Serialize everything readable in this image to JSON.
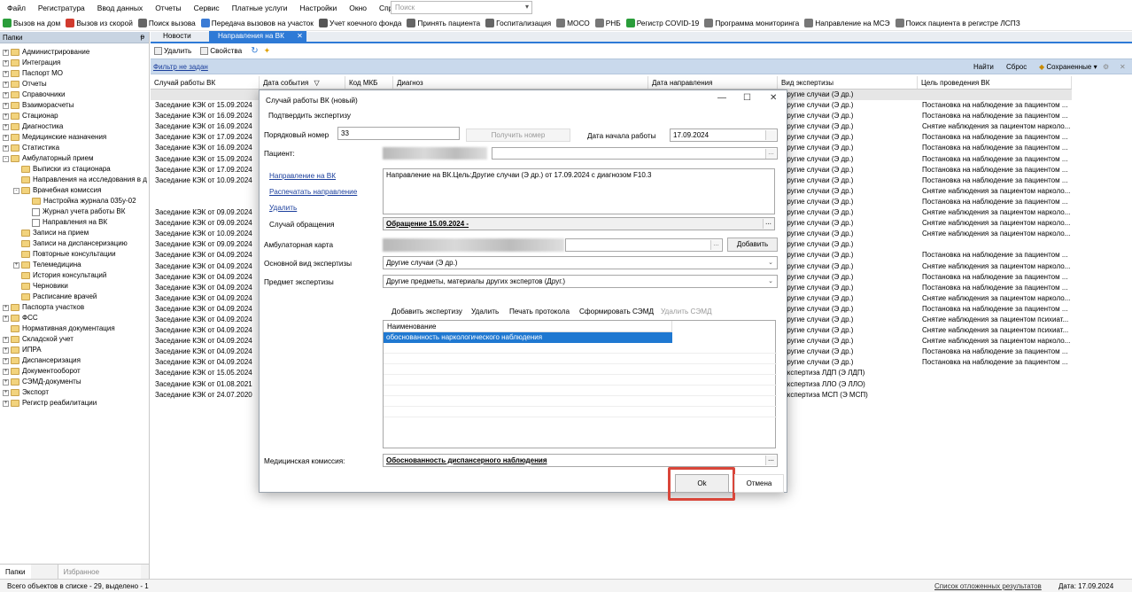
{
  "menu": [
    "Файл",
    "Регистратура",
    "Ввод данных",
    "Отчеты",
    "Сервис",
    "Платные услуги",
    "Настройки",
    "Окно",
    "Справка"
  ],
  "search": {
    "placeholder": "Поиск"
  },
  "toolbar": [
    {
      "label": "Вызов на дом",
      "icon": "home-call-icon",
      "color": "#2a9d3a"
    },
    {
      "label": "Вызов из скорой",
      "icon": "ambulance-call-icon",
      "color": "#d13a2e"
    },
    {
      "label": "Поиск вызова",
      "icon": "search-call-icon",
      "color": "#666"
    },
    {
      "label": "Передача вызовов на участок",
      "icon": "transfer-icon",
      "color": "#3a7bd5"
    },
    {
      "label": "Учет коечного фонда",
      "icon": "bed-icon",
      "color": "#555"
    },
    {
      "label": "Принять пациента",
      "icon": "accept-patient-icon",
      "color": "#666"
    },
    {
      "label": "Госпитализация",
      "icon": "hospital-icon",
      "color": "#666"
    },
    {
      "label": "МОСО",
      "icon": "moso-icon",
      "color": "#777"
    },
    {
      "label": "РНБ",
      "icon": "rnb-icon",
      "color": "#777"
    },
    {
      "label": "Регистр COVID-19",
      "icon": "covid-icon",
      "color": "#2a9d3a"
    },
    {
      "label": "Программа мониторинга",
      "icon": "monitoring-icon",
      "color": "#777"
    },
    {
      "label": "Направление на МСЭ",
      "icon": "mse-icon",
      "color": "#777"
    },
    {
      "label": "Поиск пациента в регистре ЛСПЗ",
      "icon": "register-search-icon",
      "color": "#777"
    }
  ],
  "left_panel": {
    "title": "Папки",
    "tree": [
      {
        "label": "Администрирование",
        "level": 0,
        "exp": "+"
      },
      {
        "label": "Интеграция",
        "level": 0,
        "exp": "+"
      },
      {
        "label": "Паспорт МО",
        "level": 0,
        "exp": "+"
      },
      {
        "label": "Отчеты",
        "level": 0,
        "exp": "+"
      },
      {
        "label": "Справочники",
        "level": 0,
        "exp": "+"
      },
      {
        "label": "Взаиморасчеты",
        "level": 0,
        "exp": "+"
      },
      {
        "label": "Стационар",
        "level": 0,
        "exp": "+"
      },
      {
        "label": "Диагностика",
        "level": 0,
        "exp": "+"
      },
      {
        "label": "Медицинские назначения",
        "level": 0,
        "exp": "+"
      },
      {
        "label": "Статистика",
        "level": 0,
        "exp": "+"
      },
      {
        "label": "Амбулаторный прием",
        "level": 0,
        "exp": "-"
      },
      {
        "label": "Выписки из стационара",
        "level": 1,
        "exp": ""
      },
      {
        "label": "Направления на исследования в д",
        "level": 1,
        "exp": ""
      },
      {
        "label": "Врачебная комиссия",
        "level": 1,
        "exp": "-"
      },
      {
        "label": "Настройка журнала 035у-02",
        "level": 2,
        "exp": ""
      },
      {
        "label": "Журнал учета работы ВК",
        "level": 2,
        "exp": "",
        "doc": true
      },
      {
        "label": "Направления на ВК",
        "level": 2,
        "exp": "",
        "doc": true
      },
      {
        "label": "Записи на прием",
        "level": 1,
        "exp": ""
      },
      {
        "label": "Записи на диспансеризацию",
        "level": 1,
        "exp": ""
      },
      {
        "label": "Повторные консультации",
        "level": 1,
        "exp": ""
      },
      {
        "label": "Телемедицина",
        "level": 1,
        "exp": "+"
      },
      {
        "label": "История консультаций",
        "level": 1,
        "exp": ""
      },
      {
        "label": "Черновики",
        "level": 1,
        "exp": ""
      },
      {
        "label": "Расписание врачей",
        "level": 1,
        "exp": ""
      },
      {
        "label": "Паспорта участков",
        "level": 0,
        "exp": "+"
      },
      {
        "label": "ФСС",
        "level": 0,
        "exp": "+"
      },
      {
        "label": "Нормативная документация",
        "level": 0,
        "exp": ""
      },
      {
        "label": "Складской учет",
        "level": 0,
        "exp": "+"
      },
      {
        "label": "ИПРА",
        "level": 0,
        "exp": "+"
      },
      {
        "label": "Диспансеризация",
        "level": 0,
        "exp": "+"
      },
      {
        "label": "Документооборот",
        "level": 0,
        "exp": "+"
      },
      {
        "label": "СЭМД-документы",
        "level": 0,
        "exp": "+"
      },
      {
        "label": "Экспорт",
        "level": 0,
        "exp": "+"
      },
      {
        "label": "Регистр реабилитации",
        "level": 0,
        "exp": "+"
      }
    ],
    "bottom_tabs": [
      "Папки",
      "Избранное"
    ]
  },
  "tabs": [
    "Новости",
    "Направления на ВК"
  ],
  "subtoolbar": {
    "delete": "Удалить",
    "properties": "Свойства"
  },
  "filter": {
    "label": "Фильтр не задан",
    "find": "Найти",
    "reset": "Сброс",
    "saved": "Сохраненные"
  },
  "grid": {
    "columns": [
      "Случай работы ВК",
      "Дата события",
      "Код МКБ",
      "Диагноз",
      "Дата направления",
      "Вид экспертизы",
      "Цель проведения ВК"
    ],
    "rows": [
      [
        "",
        "",
        "Другие случаи (Э др.)",
        ""
      ],
      [
        "Заседание КЭК от 15.09.2024",
        "",
        "Другие случаи (Э др.)",
        "Постановка на наблюдение за пациентом ..."
      ],
      [
        "Заседание КЭК от 16.09.2024",
        "",
        "Другие случаи (Э др.)",
        "Постановка на наблюдение за пациентом ..."
      ],
      [
        "Заседание КЭК от 16.09.2024",
        "",
        "Другие случаи (Э др.)",
        "Снятие наблюдения за пациентом нарколо..."
      ],
      [
        "Заседание КЭК от 17.09.2024",
        "",
        "Другие случаи (Э др.)",
        "Постановка на наблюдение за пациентом ..."
      ],
      [
        "Заседание КЭК от 16.09.2024",
        "",
        "Другие случаи (Э др.)",
        "Постановка на наблюдение за пациентом ..."
      ],
      [
        "Заседание КЭК от 15.09.2024",
        "",
        "Другие случаи (Э др.)",
        "Постановка на наблюдение за пациентом ..."
      ],
      [
        "Заседание КЭК от 17.09.2024",
        "",
        "Другие случаи (Э др.)",
        "Постановка на наблюдение за пациентом ..."
      ],
      [
        "Заседание КЭК от 10.09.2024",
        "",
        "Другие случаи (Э др.)",
        "Постановка на наблюдение за пациентом ..."
      ],
      [
        "",
        "",
        "Другие случаи (Э др.)",
        "Снятие наблюдения за пациентом нарколо..."
      ],
      [
        "",
        "",
        "Другие случаи (Э др.)",
        "Постановка на наблюдение за пациентом ..."
      ],
      [
        "Заседание КЭК от 09.09.2024",
        "",
        "Другие случаи (Э др.)",
        "Снятие наблюдения за пациентом нарколо..."
      ],
      [
        "Заседание КЭК от 09.09.2024",
        "",
        "Другие случаи (Э др.)",
        "Снятие наблюдения за пациентом нарколо..."
      ],
      [
        "Заседание КЭК от 10.09.2024",
        "",
        "Другие случаи (Э др.)",
        "Снятие наблюдения за пациентом нарколо..."
      ],
      [
        "Заседание КЭК от 09.09.2024",
        "",
        "Другие случаи (Э др.)",
        ""
      ],
      [
        "Заседание КЭК от 04.09.2024",
        "",
        "Другие случаи (Э др.)",
        "Постановка на наблюдение за пациентом ..."
      ],
      [
        "Заседание КЭК от 04.09.2024",
        "",
        "Другие случаи (Э др.)",
        "Снятие наблюдения за пациентом нарколо..."
      ],
      [
        "Заседание КЭК от 04.09.2024",
        "",
        "Другие случаи (Э др.)",
        "Постановка на наблюдение за пациентом ..."
      ],
      [
        "Заседание КЭК от 04.09.2024",
        "",
        "Другие случаи (Э др.)",
        "Постановка на наблюдение за пациентом ..."
      ],
      [
        "Заседание КЭК от 04.09.2024",
        "",
        "Другие случаи (Э др.)",
        "Снятие наблюдения за пациентом нарколо..."
      ],
      [
        "Заседание КЭК от 04.09.2024",
        "",
        "Другие случаи (Э др.)",
        "Постановка на наблюдение за пациентом ..."
      ],
      [
        "Заседание КЭК от 04.09.2024",
        "",
        "Другие случаи (Э др.)",
        "Снятие наблюдения за пациентом психиат..."
      ],
      [
        "Заседание КЭК от 04.09.2024",
        "",
        "Другие случаи (Э др.)",
        "Снятие наблюдения за пациентом психиат..."
      ],
      [
        "Заседание КЭК от 04.09.2024",
        "",
        "Другие случаи (Э др.)",
        "Снятие наблюдения за пациентом нарколо..."
      ],
      [
        "Заседание КЭК от 04.09.2024",
        "",
        "Другие случаи (Э др.)",
        "Постановка на наблюдение за пациентом ..."
      ],
      [
        "Заседание КЭК от 04.09.2024",
        "",
        "Другие случаи (Э др.)",
        "Постановка на наблюдение за пациентом ..."
      ],
      [
        "Заседание КЭК от 15.05.2024",
        "",
        "Экспертиза ЛДП (Э ЛДП)",
        ""
      ],
      [
        "Заседание КЭК от 01.08.2021",
        "",
        "Экспертиза ЛЛО (Э ЛЛО)",
        ""
      ],
      [
        "Заседание КЭК от 24.07.2020",
        "",
        "Экспертиза МСП (Э МСП)",
        ""
      ]
    ]
  },
  "status": {
    "count": "Всего объектов в списке - 29, выделено - 1",
    "deferred": "Список отложенных результатов",
    "date": "Дата: 17.09.2024"
  },
  "dialog": {
    "title": "Случай работы ВК (новый)",
    "confirm": "Подтвердить экспертизу",
    "order_label": "Порядковый номер",
    "order_value": "33",
    "get_number": "Получить номер",
    "start_date_label": "Дата начала работы",
    "start_date_value": "17.09.2024",
    "patient_label": "Пациент:",
    "link_referral": "Направление на ВК",
    "link_print": "Распечатать направление",
    "link_delete": "Удалить",
    "referral_text": "Направление на ВК.Цель:Другие случаи (Э др.) от 17.09.2024 с диагнозом F10.3",
    "case_label": "Случай обращения",
    "case_value": "Обращение 15.09.2024 -",
    "card_label": "Амбулаторная карта",
    "add": "Добавить",
    "main_type_label": "Основной вид экспертизы",
    "main_type_value": "Другие случаи (Э др.)",
    "subject_label": "Предмет экспертизы",
    "subject_value": "Другие предметы, материалы других экспертов (Друг.)",
    "exp_toolbar": [
      "Добавить экспертизу",
      "Удалить",
      "Печать протокола",
      "Сформировать СЭМД",
      "Удалить СЭМД"
    ],
    "list_header": "Наименование",
    "list_item": "обоснованность наркологического наблюдения",
    "commission_label": "Медицинская комиссия:",
    "commission_value": "Обоснованность диспансерного наблюдения",
    "ok": "Ok",
    "cancel": "Отмена"
  }
}
